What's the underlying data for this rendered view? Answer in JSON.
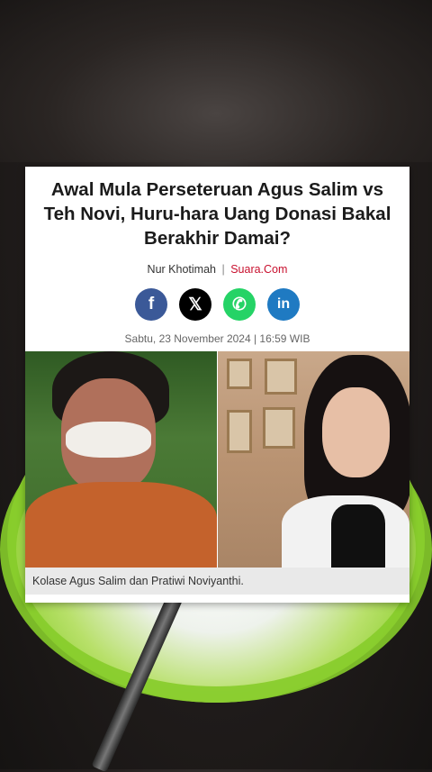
{
  "article": {
    "headline": "Awal Mula Perseteruan Agus Salim vs Teh Novi, Huru-hara Uang Donasi Bakal Berakhir Damai?",
    "author": "Nur Khotimah",
    "separator": "|",
    "source": "Suara.Com",
    "date": "Sabtu, 23 November 2024 | 16:59 WIB",
    "caption": "Kolase Agus Salim dan Pratiwi Noviyanthi."
  },
  "share": {
    "facebook": "f",
    "x": "𝕏",
    "whatsapp": "✆",
    "linkedin": "in"
  },
  "colors": {
    "source_red": "#c8102e",
    "facebook": "#3b5998",
    "x": "#000000",
    "whatsapp": "#25d366",
    "linkedin": "#1f7ac2"
  }
}
